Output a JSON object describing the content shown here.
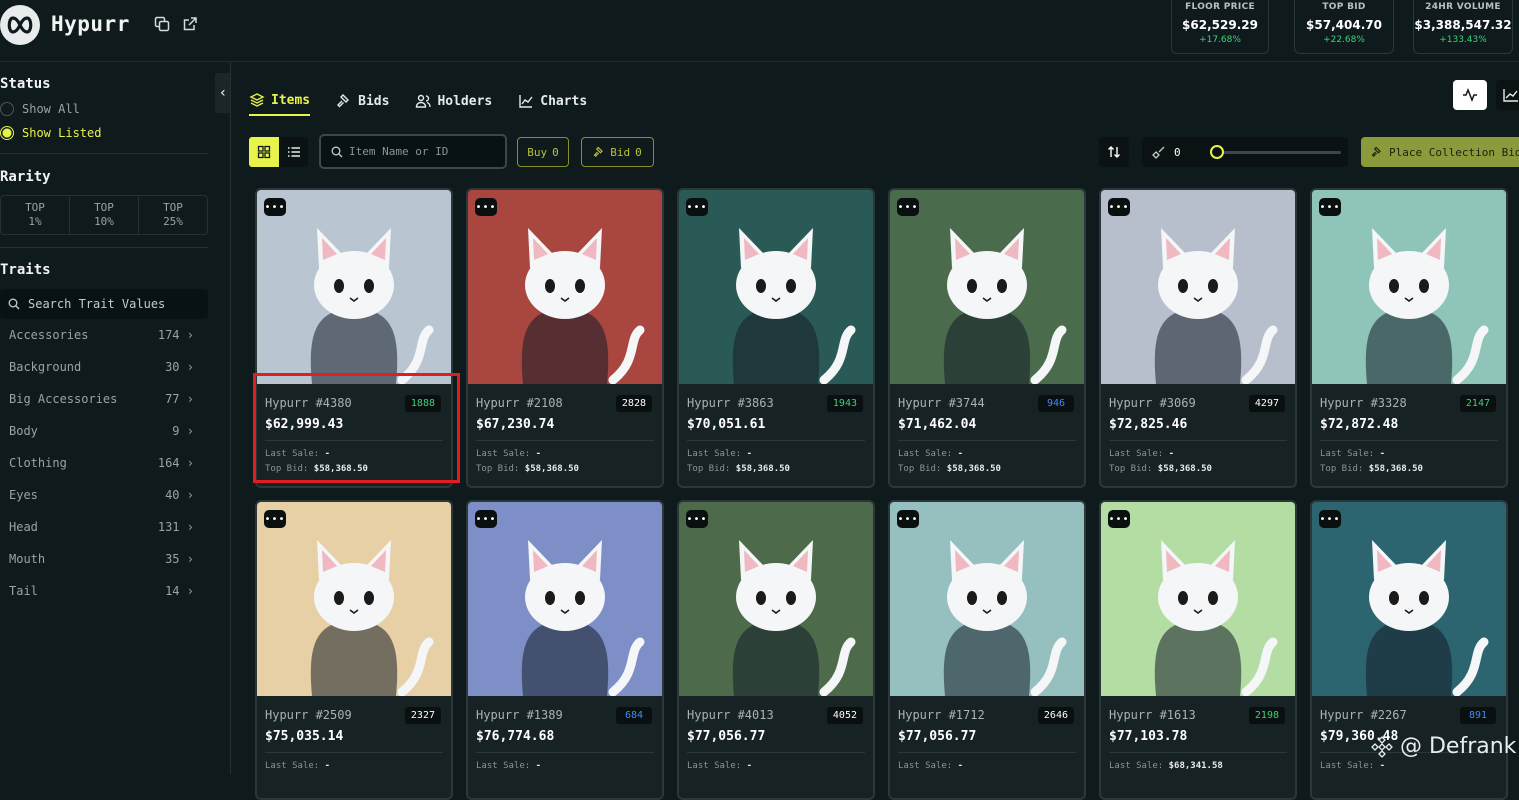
{
  "app": {
    "name": "Hypurr"
  },
  "stats": [
    {
      "label": "FLOOR PRICE",
      "value": "$62,529.29",
      "change": "+17.68%"
    },
    {
      "label": "TOP BID",
      "value": "$57,404.70",
      "change": "+22.68%"
    },
    {
      "label": "24HR VOLUME",
      "value": "$3,388,547.32",
      "change": "+133.43%"
    }
  ],
  "sidebar": {
    "status_title": "Status",
    "status_options": [
      {
        "label": "Show All",
        "selected": false
      },
      {
        "label": "Show Listed",
        "selected": true
      }
    ],
    "rarity_title": "Rarity",
    "rarity_options": [
      {
        "line1": "TOP",
        "line2": "1%"
      },
      {
        "line1": "TOP",
        "line2": "10%"
      },
      {
        "line1": "TOP",
        "line2": "25%"
      }
    ],
    "traits_title": "Traits",
    "trait_search_placeholder": "Search Trait Values",
    "traits": [
      {
        "name": "Accessories",
        "count": "174"
      },
      {
        "name": "Background",
        "count": "30"
      },
      {
        "name": "Big Accessories",
        "count": "77"
      },
      {
        "name": "Body",
        "count": "9"
      },
      {
        "name": "Clothing",
        "count": "164"
      },
      {
        "name": "Eyes",
        "count": "40"
      },
      {
        "name": "Head",
        "count": "131"
      },
      {
        "name": "Mouth",
        "count": "35"
      },
      {
        "name": "Tail",
        "count": "14"
      }
    ]
  },
  "tabs": [
    {
      "label": "Items",
      "active": true
    },
    {
      "label": "Bids",
      "active": false
    },
    {
      "label": "Holders",
      "active": false
    },
    {
      "label": "Charts",
      "active": false
    }
  ],
  "toolbar": {
    "search_placeholder": "Item Name or ID",
    "buy_label": "Buy",
    "buy_count": "0",
    "bid_label": "Bid",
    "bid_count": "0",
    "sweep_count": "0",
    "place_bid_label": "Place Collection Bid"
  },
  "card_labels": {
    "last_sale": "Last Sale:",
    "top_bid": "Top Bid:"
  },
  "items": [
    {
      "name": "Hypurr #4380",
      "rank": "1888",
      "rank_color": "#3fd07a",
      "price": "$62,999.43",
      "last_sale": "-",
      "top_bid": "$58,368.50",
      "bg": "#b9c6d2"
    },
    {
      "name": "Hypurr #2108",
      "rank": "2828",
      "rank_color": "#ffffff",
      "price": "$67,230.74",
      "last_sale": "-",
      "top_bid": "$58,368.50",
      "bg": "#a8463f"
    },
    {
      "name": "Hypurr #3863",
      "rank": "1943",
      "rank_color": "#3fd07a",
      "price": "$70,051.61",
      "last_sale": "-",
      "top_bid": "$58,368.50",
      "bg": "#2a5a55"
    },
    {
      "name": "Hypurr #3744",
      "rank": "946",
      "rank_color": "#3d8bff",
      "price": "$71,462.04",
      "last_sale": "-",
      "top_bid": "$58,368.50",
      "bg": "#4a6b4c"
    },
    {
      "name": "Hypurr #3069",
      "rank": "4297",
      "rank_color": "#ffffff",
      "price": "$72,825.46",
      "last_sale": "-",
      "top_bid": "$58,368.50",
      "bg": "#b7bfcc"
    },
    {
      "name": "Hypurr #3328",
      "rank": "2147",
      "rank_color": "#3fd07a",
      "price": "$72,872.48",
      "last_sale": "-",
      "top_bid": "$58,368.50",
      "bg": "#8fc4b9"
    },
    {
      "name": "Hypurr #2509",
      "rank": "2327",
      "rank_color": "#ffffff",
      "price": "$75,035.14",
      "last_sale": "-",
      "top_bid": "",
      "bg": "#e8d0a6"
    },
    {
      "name": "Hypurr #1389",
      "rank": "684",
      "rank_color": "#3d8bff",
      "price": "$76,774.68",
      "last_sale": "-",
      "top_bid": "",
      "bg": "#7d8fc6"
    },
    {
      "name": "Hypurr #4013",
      "rank": "4052",
      "rank_color": "#ffffff",
      "price": "$77,056.77",
      "last_sale": "-",
      "top_bid": "",
      "bg": "#4d6a4a"
    },
    {
      "name": "Hypurr #1712",
      "rank": "2646",
      "rank_color": "#ffffff",
      "price": "$77,056.77",
      "last_sale": "-",
      "top_bid": "",
      "bg": "#95c0bf"
    },
    {
      "name": "Hypurr #1613",
      "rank": "2198",
      "rank_color": "#3fd07a",
      "price": "$77,103.78",
      "last_sale": "$68,341.58",
      "top_bid": "",
      "bg": "#b3dda2"
    },
    {
      "name": "Hypurr #2267",
      "rank": "891",
      "rank_color": "#3d8bff",
      "price": "$79,360.48",
      "last_sale": "-",
      "top_bid": "",
      "bg": "#2c6470"
    }
  ],
  "colors": {
    "accent": "#e8f34b",
    "highlight": "#e01e22"
  },
  "watermark": {
    "text": "@ Defrank"
  }
}
